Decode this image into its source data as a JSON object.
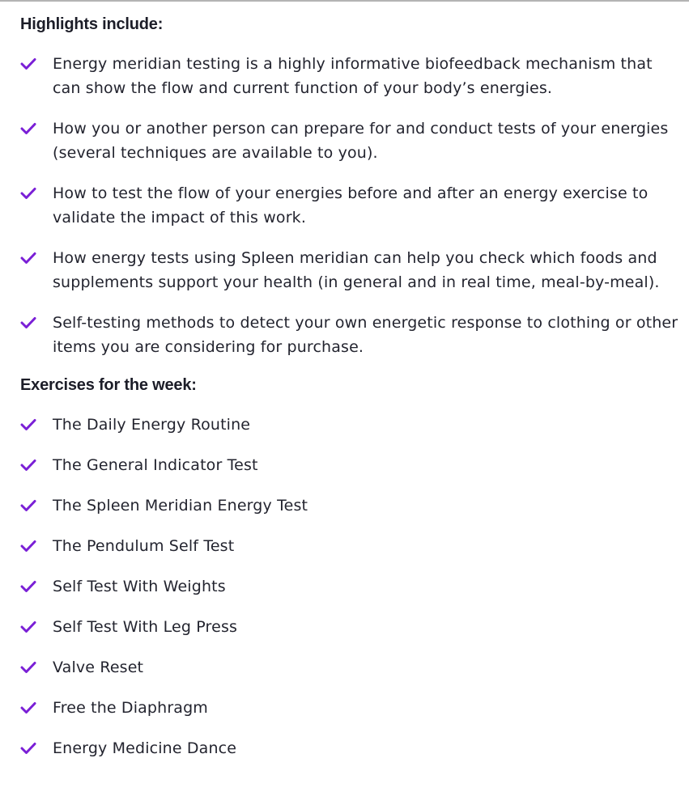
{
  "colors": {
    "accent": "#7a1fd6",
    "text": "#23242f",
    "heading": "#1c1d28",
    "rule": "#b4b4b4"
  },
  "highlights": {
    "heading": "Highlights include:",
    "icon": "check-icon",
    "items": [
      "Energy meridian testing is a highly informative biofeedback mechanism that can show the flow and current function of your body’s energies.",
      "How you or another person can prepare for and conduct tests of your energies (several techniques are available to you).",
      "How to test the flow of your energies before and after an energy exercise to validate the impact of this work.",
      "How energy tests using Spleen meridian can help you check which foods and supplements support your health (in general and in real time, meal-by-meal).",
      "Self-testing methods to detect your own energetic response to clothing or other items you are considering for purchase."
    ]
  },
  "exercises": {
    "heading": "Exercises for the week:",
    "icon": "check-icon",
    "items": [
      "The Daily Energy Routine",
      "The General Indicator Test",
      "The Spleen Meridian Energy Test",
      "The Pendulum Self Test",
      "Self Test With Weights",
      "Self Test With Leg Press",
      "Valve Reset",
      "Free the Diaphragm",
      "Energy Medicine Dance"
    ]
  }
}
